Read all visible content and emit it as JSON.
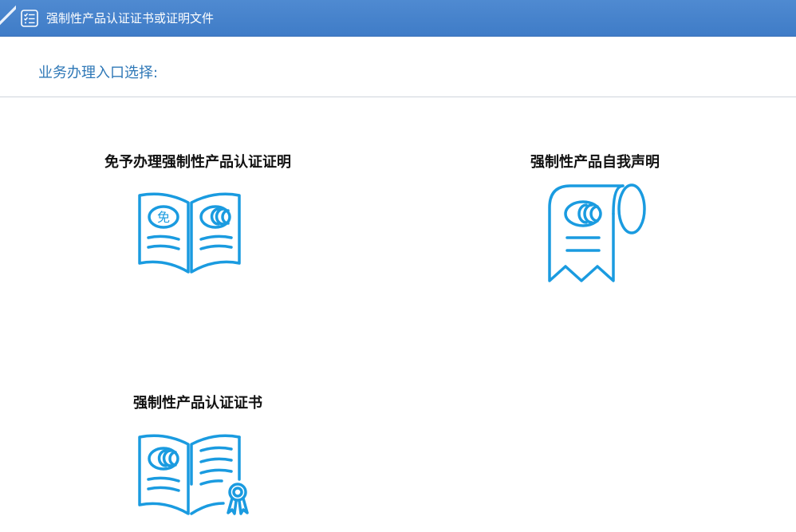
{
  "window": {
    "title": "强制性产品认证证书或证明文件",
    "title_icon": "checklist-icon"
  },
  "main": {
    "section_label": "业务办理入口选择:",
    "options": [
      {
        "label": "免予办理强制性产品认证证明",
        "icon": "open-book-exempt-ccc-icon",
        "icon_text": "免"
      },
      {
        "label": "强制性产品自我声明",
        "icon": "scroll-ccc-declaration-icon"
      },
      {
        "label": "强制性产品认证证书",
        "icon": "open-book-certificate-ribbon-icon"
      }
    ]
  },
  "colors": {
    "titlebar": "#4483cc",
    "accent_text": "#2f78b7",
    "icon_blue": "#1a9be0"
  }
}
